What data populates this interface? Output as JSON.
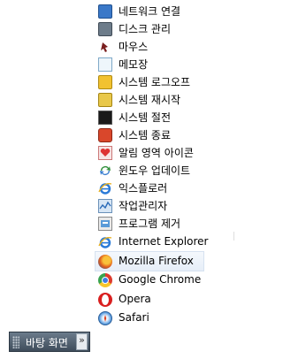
{
  "menu": {
    "items": [
      {
        "label": "네트워크 연결",
        "icon": "network-icon"
      },
      {
        "label": "디스크 관리",
        "icon": "disk-icon"
      },
      {
        "label": "마우스",
        "icon": "mouse-icon"
      },
      {
        "label": "메모장",
        "icon": "notepad-icon"
      },
      {
        "label": "시스템 로그오프",
        "icon": "key-icon"
      },
      {
        "label": "시스템 재시작",
        "icon": "restart-key-icon"
      },
      {
        "label": "시스템 절전",
        "icon": "terminal-icon"
      },
      {
        "label": "시스템 종료",
        "icon": "power-icon"
      },
      {
        "label": "알림 영역 아이콘",
        "icon": "notification-icon"
      },
      {
        "label": "윈도우 업데이트",
        "icon": "windows-update-icon"
      },
      {
        "label": "익스플로러",
        "icon": "internet-explorer-icon"
      },
      {
        "label": "작업관리자",
        "icon": "task-manager-icon"
      },
      {
        "label": "프로그램 제거",
        "icon": "programs-icon"
      },
      {
        "label": "Internet Explorer",
        "icon": "internet-explorer-icon"
      },
      {
        "label": "Mozilla Firefox",
        "icon": "firefox-icon"
      },
      {
        "label": "Google Chrome",
        "icon": "chrome-icon"
      },
      {
        "label": "Opera",
        "icon": "opera-icon"
      },
      {
        "label": "Safari",
        "icon": "safari-icon"
      }
    ]
  },
  "taskbar": {
    "button_label": "바탕 화면",
    "chevron": "»"
  },
  "colors": {
    "hover_bg": "#e6eef8",
    "taskbar_bg": "#4f5e6d"
  }
}
